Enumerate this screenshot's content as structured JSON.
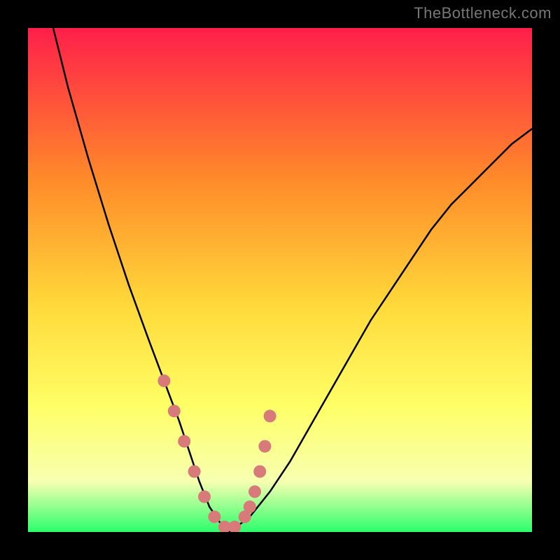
{
  "watermark": "TheBottleneck.com",
  "colors": {
    "frame": "#000000",
    "curve": "#000000",
    "dot": "#d87a7a",
    "gradient_stops": [
      "#ff1f4a",
      "#ff8a2a",
      "#ffd93a",
      "#ffff66",
      "#f7ffb0",
      "#2bff6b"
    ]
  },
  "chart_data": {
    "type": "line",
    "title": "",
    "xlabel": "",
    "ylabel": "",
    "xlim": [
      0,
      100
    ],
    "ylim": [
      0,
      100
    ],
    "series": [
      {
        "name": "bottleneck-curve",
        "x": [
          5,
          8,
          12,
          16,
          20,
          24,
          27,
          30,
          32,
          34,
          36,
          38,
          40,
          44,
          48,
          52,
          56,
          60,
          64,
          68,
          72,
          76,
          80,
          84,
          88,
          92,
          96,
          100
        ],
        "values": [
          100,
          88,
          74,
          61,
          49,
          38,
          30,
          22,
          16,
          10,
          5,
          2,
          0,
          3,
          8,
          14,
          21,
          28,
          35,
          42,
          48,
          54,
          60,
          65,
          69,
          73,
          77,
          80
        ]
      }
    ],
    "markers": [
      {
        "name": "highlight-dots",
        "x": [
          27,
          29,
          31,
          33,
          35,
          37,
          39,
          41,
          43,
          44,
          45,
          46,
          47,
          48
        ],
        "values": [
          30,
          24,
          18,
          12,
          7,
          3,
          1,
          1,
          3,
          5,
          8,
          12,
          17,
          23
        ]
      }
    ]
  }
}
